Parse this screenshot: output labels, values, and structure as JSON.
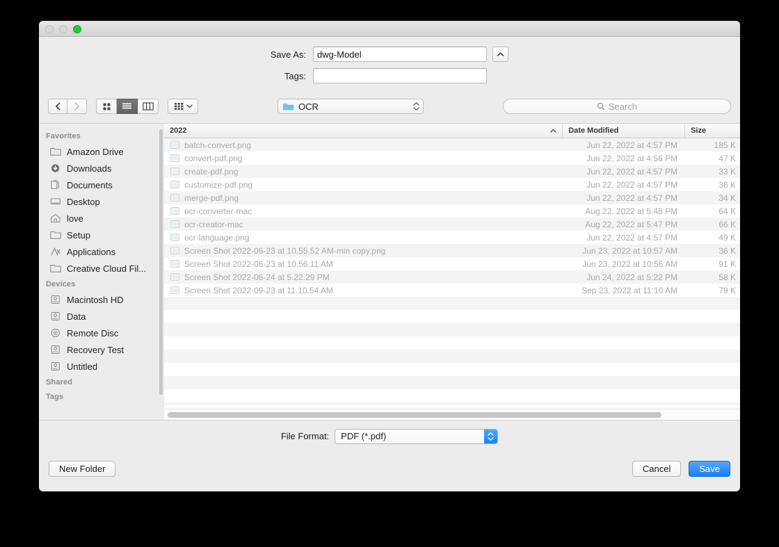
{
  "window": {
    "traffic_lights": [
      "close",
      "minimize",
      "zoom"
    ]
  },
  "form": {
    "save_as_label": "Save As:",
    "save_as_value": "dwg-Model",
    "tags_label": "Tags:",
    "tags_value": "",
    "tags_placeholder": "",
    "expand_icon": "chevron-up-icon"
  },
  "toolbar": {
    "back_icon": "chevron-left-icon",
    "forward_icon": "chevron-right-icon",
    "view_icon": "icon-view-icon",
    "view_list": "list-view-icon",
    "view_column": "column-view-icon",
    "arrange_icon": "arrange-by-icon",
    "location": "OCR",
    "location_icon": "folder-icon",
    "search_placeholder": "Search",
    "search_icon": "search-icon"
  },
  "sidebar": {
    "sections": [
      {
        "header": "Favorites",
        "items": [
          {
            "label": "Amazon Drive",
            "icon": "folder-icon"
          },
          {
            "label": "Downloads",
            "icon": "downloads-icon"
          },
          {
            "label": "Documents",
            "icon": "documents-icon"
          },
          {
            "label": "Desktop",
            "icon": "desktop-icon"
          },
          {
            "label": "love",
            "icon": "home-icon"
          },
          {
            "label": "Setup",
            "icon": "folder-icon"
          },
          {
            "label": "Applications",
            "icon": "applications-icon"
          },
          {
            "label": "Creative Cloud Fil...",
            "icon": "folder-icon"
          }
        ]
      },
      {
        "header": "Devices",
        "items": [
          {
            "label": "Macintosh HD",
            "icon": "harddisk-icon"
          },
          {
            "label": "Data",
            "icon": "harddisk-icon"
          },
          {
            "label": "Remote Disc",
            "icon": "disc-icon"
          },
          {
            "label": "Recovery Test",
            "icon": "harddisk-icon"
          },
          {
            "label": "Untitled",
            "icon": "harddisk-icon"
          }
        ]
      },
      {
        "header": "Shared",
        "items": []
      },
      {
        "header": "Tags",
        "items": []
      }
    ]
  },
  "filelist": {
    "columns": {
      "name": "2022",
      "date": "Date Modified",
      "size": "Size",
      "sort_icon": "sort-ascending-icon"
    },
    "rows": [
      {
        "name": "batch-convert.png",
        "date": "Jun 22, 2022 at 4:57 PM",
        "size": "185 K",
        "icon": "image-file-icon"
      },
      {
        "name": "convert-pdf.png",
        "date": "Jun 22, 2022 at 4:56 PM",
        "size": "47 K",
        "icon": "image-file-icon"
      },
      {
        "name": "create-pdf.png",
        "date": "Jun 22, 2022 at 4:57 PM",
        "size": "33 K",
        "icon": "image-file-icon"
      },
      {
        "name": "customize-pdf.png",
        "date": "Jun 22, 2022 at 4:57 PM",
        "size": "36 K",
        "icon": "image-file-icon"
      },
      {
        "name": "merge-pdf.png",
        "date": "Jun 22, 2022 at 4:57 PM",
        "size": "34 K",
        "icon": "image-file-icon"
      },
      {
        "name": "ocr-converter-mac",
        "date": "Aug 22, 2022 at 5:48 PM",
        "size": "64 K",
        "icon": "image-file-icon"
      },
      {
        "name": "ocr-creator-mac",
        "date": "Aug 22, 2022 at 5:47 PM",
        "size": "66 K",
        "icon": "image-file-icon"
      },
      {
        "name": "ocr-language.png",
        "date": "Jun 22, 2022 at 4:57 PM",
        "size": "49 K",
        "icon": "image-file-icon"
      },
      {
        "name": "Screen Shot 2022-06-23 at 10.55.52 AM-min copy.png",
        "date": "Jun 23, 2022 at 10:57 AM",
        "size": "36 K",
        "icon": "image-file-icon"
      },
      {
        "name": "Screen Shot 2022-06-23 at 10.56.11 AM",
        "date": "Jun 23, 2022 at 10:56 AM",
        "size": "91 K",
        "icon": "image-file-icon"
      },
      {
        "name": "Screen Shot 2022-06-24 at 5.22.29 PM",
        "date": "Jun 24, 2022 at 5:22 PM",
        "size": "58 K",
        "icon": "image-file-icon"
      },
      {
        "name": "Screen Shot 2022-09-23 at 11.10.54 AM",
        "date": "Sep 23, 2022 at 11:10 AM",
        "size": "79 K",
        "icon": "image-file-icon"
      }
    ],
    "empty_row_count": 9
  },
  "format": {
    "label": "File Format:",
    "value": "PDF (*.pdf)"
  },
  "buttons": {
    "new_folder": "New Folder",
    "cancel": "Cancel",
    "save": "Save"
  },
  "colors": {
    "accent": "#1b7ef3",
    "green_light": "#28c940",
    "folder_blue": "#6fc3ef",
    "disabled_text": "#a9a9a9"
  }
}
